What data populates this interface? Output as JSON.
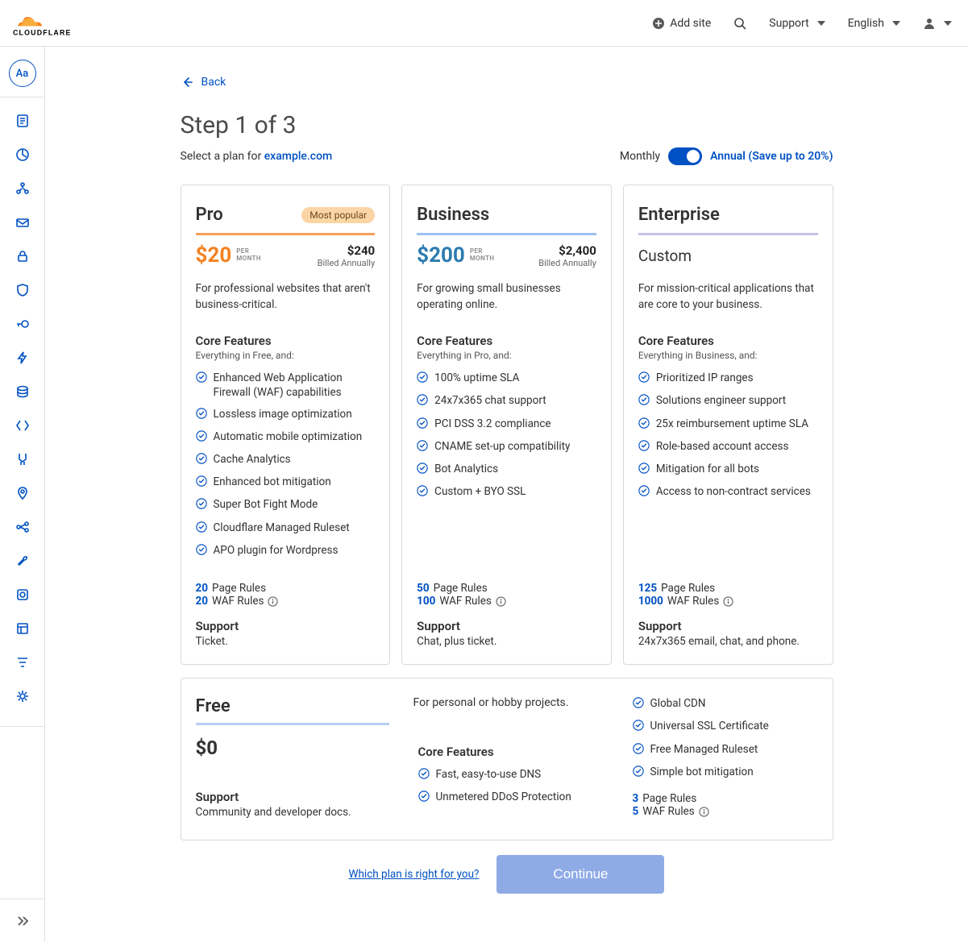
{
  "header": {
    "add_site": "Add site",
    "support": "Support",
    "language": "English"
  },
  "sidebar": {
    "avatar": "Aa"
  },
  "back_label": "Back",
  "step_title": "Step 1 of 3",
  "subtitle_prefix": "Select a plan for ",
  "domain": "example.com",
  "billing": {
    "monthly": "Monthly",
    "annual": "Annual (Save up to 20%)"
  },
  "plans": {
    "pro": {
      "name": "Pro",
      "badge": "Most popular",
      "price": "$20",
      "unit1": "PER",
      "unit2": "MONTH",
      "annual_amount": "$240",
      "annual_label": "Billed Annually",
      "desc": "For professional websites that aren't business-critical.",
      "core_h": "Core Features",
      "core_sub": "Everything in Free, and:",
      "features": [
        "Enhanced Web Application Firewall (WAF) capabilities",
        "Lossless image optimization",
        "Automatic mobile optimization",
        "Cache Analytics",
        "Enhanced bot mitigation",
        "Super Bot Fight Mode",
        "Cloudflare Managed Ruleset",
        "APO plugin for Wordpress"
      ],
      "page_rules_n": "20",
      "page_rules_l": "Page Rules",
      "waf_rules_n": "20",
      "waf_rules_l": "WAF Rules",
      "support_h": "Support",
      "support_t": "Ticket."
    },
    "business": {
      "name": "Business",
      "price": "$200",
      "unit1": "PER",
      "unit2": "MONTH",
      "annual_amount": "$2,400",
      "annual_label": "Billed Annually",
      "desc": "For growing small businesses operating online.",
      "core_h": "Core Features",
      "core_sub": "Everything in Pro, and:",
      "features": [
        "100% uptime SLA",
        "24x7x365 chat support",
        "PCI DSS 3.2 compliance",
        "CNAME set-up compatibility",
        "Bot Analytics",
        "Custom + BYO SSL"
      ],
      "page_rules_n": "50",
      "page_rules_l": "Page Rules",
      "waf_rules_n": "100",
      "waf_rules_l": "WAF Rules",
      "support_h": "Support",
      "support_t": "Chat, plus ticket."
    },
    "enterprise": {
      "name": "Enterprise",
      "custom": "Custom",
      "desc": "For mission-critical applications that are core to your business.",
      "core_h": "Core Features",
      "core_sub": "Everything in Business, and:",
      "features": [
        "Prioritized IP ranges",
        "Solutions engineer support",
        "25x reimbursement uptime SLA",
        "Role-based account access",
        "Mitigation for all bots",
        "Access to non-contract services"
      ],
      "page_rules_n": "125",
      "page_rules_l": "Page Rules",
      "waf_rules_n": "1000",
      "waf_rules_l": "WAF Rules",
      "support_h": "Support",
      "support_t": "24x7x365 email, chat, and phone."
    },
    "free": {
      "name": "Free",
      "price": "$0",
      "desc": "For personal or hobby projects.",
      "core_h": "Core Features",
      "features_col2": [
        "Fast, easy-to-use DNS",
        "Unmetered DDoS Protection"
      ],
      "features_col3": [
        "Global CDN",
        "Universal SSL Certificate",
        "Free Managed Ruleset",
        "Simple bot mitigation"
      ],
      "page_rules_n": "3",
      "page_rules_l": "Page Rules",
      "waf_rules_n": "5",
      "waf_rules_l": "WAF Rules",
      "support_h": "Support",
      "support_t": "Community and developer docs."
    }
  },
  "footer": {
    "which_link": "Which plan is right for you?",
    "continue": "Continue"
  }
}
